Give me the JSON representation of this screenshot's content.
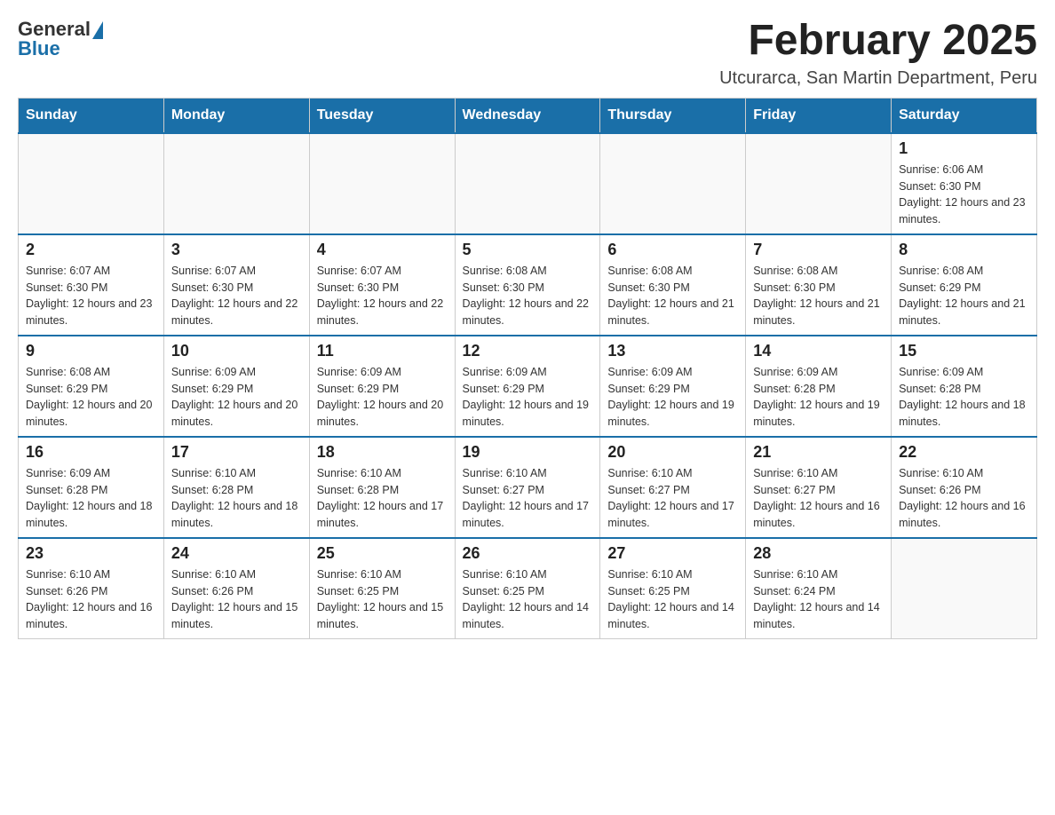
{
  "header": {
    "logo_general": "General",
    "logo_blue": "Blue",
    "month_title": "February 2025",
    "location": "Utcurarca, San Martin Department, Peru"
  },
  "weekdays": [
    "Sunday",
    "Monday",
    "Tuesday",
    "Wednesday",
    "Thursday",
    "Friday",
    "Saturday"
  ],
  "weeks": [
    [
      {
        "day": "",
        "info": ""
      },
      {
        "day": "",
        "info": ""
      },
      {
        "day": "",
        "info": ""
      },
      {
        "day": "",
        "info": ""
      },
      {
        "day": "",
        "info": ""
      },
      {
        "day": "",
        "info": ""
      },
      {
        "day": "1",
        "info": "Sunrise: 6:06 AM\nSunset: 6:30 PM\nDaylight: 12 hours and 23 minutes."
      }
    ],
    [
      {
        "day": "2",
        "info": "Sunrise: 6:07 AM\nSunset: 6:30 PM\nDaylight: 12 hours and 23 minutes."
      },
      {
        "day": "3",
        "info": "Sunrise: 6:07 AM\nSunset: 6:30 PM\nDaylight: 12 hours and 22 minutes."
      },
      {
        "day": "4",
        "info": "Sunrise: 6:07 AM\nSunset: 6:30 PM\nDaylight: 12 hours and 22 minutes."
      },
      {
        "day": "5",
        "info": "Sunrise: 6:08 AM\nSunset: 6:30 PM\nDaylight: 12 hours and 22 minutes."
      },
      {
        "day": "6",
        "info": "Sunrise: 6:08 AM\nSunset: 6:30 PM\nDaylight: 12 hours and 21 minutes."
      },
      {
        "day": "7",
        "info": "Sunrise: 6:08 AM\nSunset: 6:30 PM\nDaylight: 12 hours and 21 minutes."
      },
      {
        "day": "8",
        "info": "Sunrise: 6:08 AM\nSunset: 6:29 PM\nDaylight: 12 hours and 21 minutes."
      }
    ],
    [
      {
        "day": "9",
        "info": "Sunrise: 6:08 AM\nSunset: 6:29 PM\nDaylight: 12 hours and 20 minutes."
      },
      {
        "day": "10",
        "info": "Sunrise: 6:09 AM\nSunset: 6:29 PM\nDaylight: 12 hours and 20 minutes."
      },
      {
        "day": "11",
        "info": "Sunrise: 6:09 AM\nSunset: 6:29 PM\nDaylight: 12 hours and 20 minutes."
      },
      {
        "day": "12",
        "info": "Sunrise: 6:09 AM\nSunset: 6:29 PM\nDaylight: 12 hours and 19 minutes."
      },
      {
        "day": "13",
        "info": "Sunrise: 6:09 AM\nSunset: 6:29 PM\nDaylight: 12 hours and 19 minutes."
      },
      {
        "day": "14",
        "info": "Sunrise: 6:09 AM\nSunset: 6:28 PM\nDaylight: 12 hours and 19 minutes."
      },
      {
        "day": "15",
        "info": "Sunrise: 6:09 AM\nSunset: 6:28 PM\nDaylight: 12 hours and 18 minutes."
      }
    ],
    [
      {
        "day": "16",
        "info": "Sunrise: 6:09 AM\nSunset: 6:28 PM\nDaylight: 12 hours and 18 minutes."
      },
      {
        "day": "17",
        "info": "Sunrise: 6:10 AM\nSunset: 6:28 PM\nDaylight: 12 hours and 18 minutes."
      },
      {
        "day": "18",
        "info": "Sunrise: 6:10 AM\nSunset: 6:28 PM\nDaylight: 12 hours and 17 minutes."
      },
      {
        "day": "19",
        "info": "Sunrise: 6:10 AM\nSunset: 6:27 PM\nDaylight: 12 hours and 17 minutes."
      },
      {
        "day": "20",
        "info": "Sunrise: 6:10 AM\nSunset: 6:27 PM\nDaylight: 12 hours and 17 minutes."
      },
      {
        "day": "21",
        "info": "Sunrise: 6:10 AM\nSunset: 6:27 PM\nDaylight: 12 hours and 16 minutes."
      },
      {
        "day": "22",
        "info": "Sunrise: 6:10 AM\nSunset: 6:26 PM\nDaylight: 12 hours and 16 minutes."
      }
    ],
    [
      {
        "day": "23",
        "info": "Sunrise: 6:10 AM\nSunset: 6:26 PM\nDaylight: 12 hours and 16 minutes."
      },
      {
        "day": "24",
        "info": "Sunrise: 6:10 AM\nSunset: 6:26 PM\nDaylight: 12 hours and 15 minutes."
      },
      {
        "day": "25",
        "info": "Sunrise: 6:10 AM\nSunset: 6:25 PM\nDaylight: 12 hours and 15 minutes."
      },
      {
        "day": "26",
        "info": "Sunrise: 6:10 AM\nSunset: 6:25 PM\nDaylight: 12 hours and 14 minutes."
      },
      {
        "day": "27",
        "info": "Sunrise: 6:10 AM\nSunset: 6:25 PM\nDaylight: 12 hours and 14 minutes."
      },
      {
        "day": "28",
        "info": "Sunrise: 6:10 AM\nSunset: 6:24 PM\nDaylight: 12 hours and 14 minutes."
      },
      {
        "day": "",
        "info": ""
      }
    ]
  ]
}
